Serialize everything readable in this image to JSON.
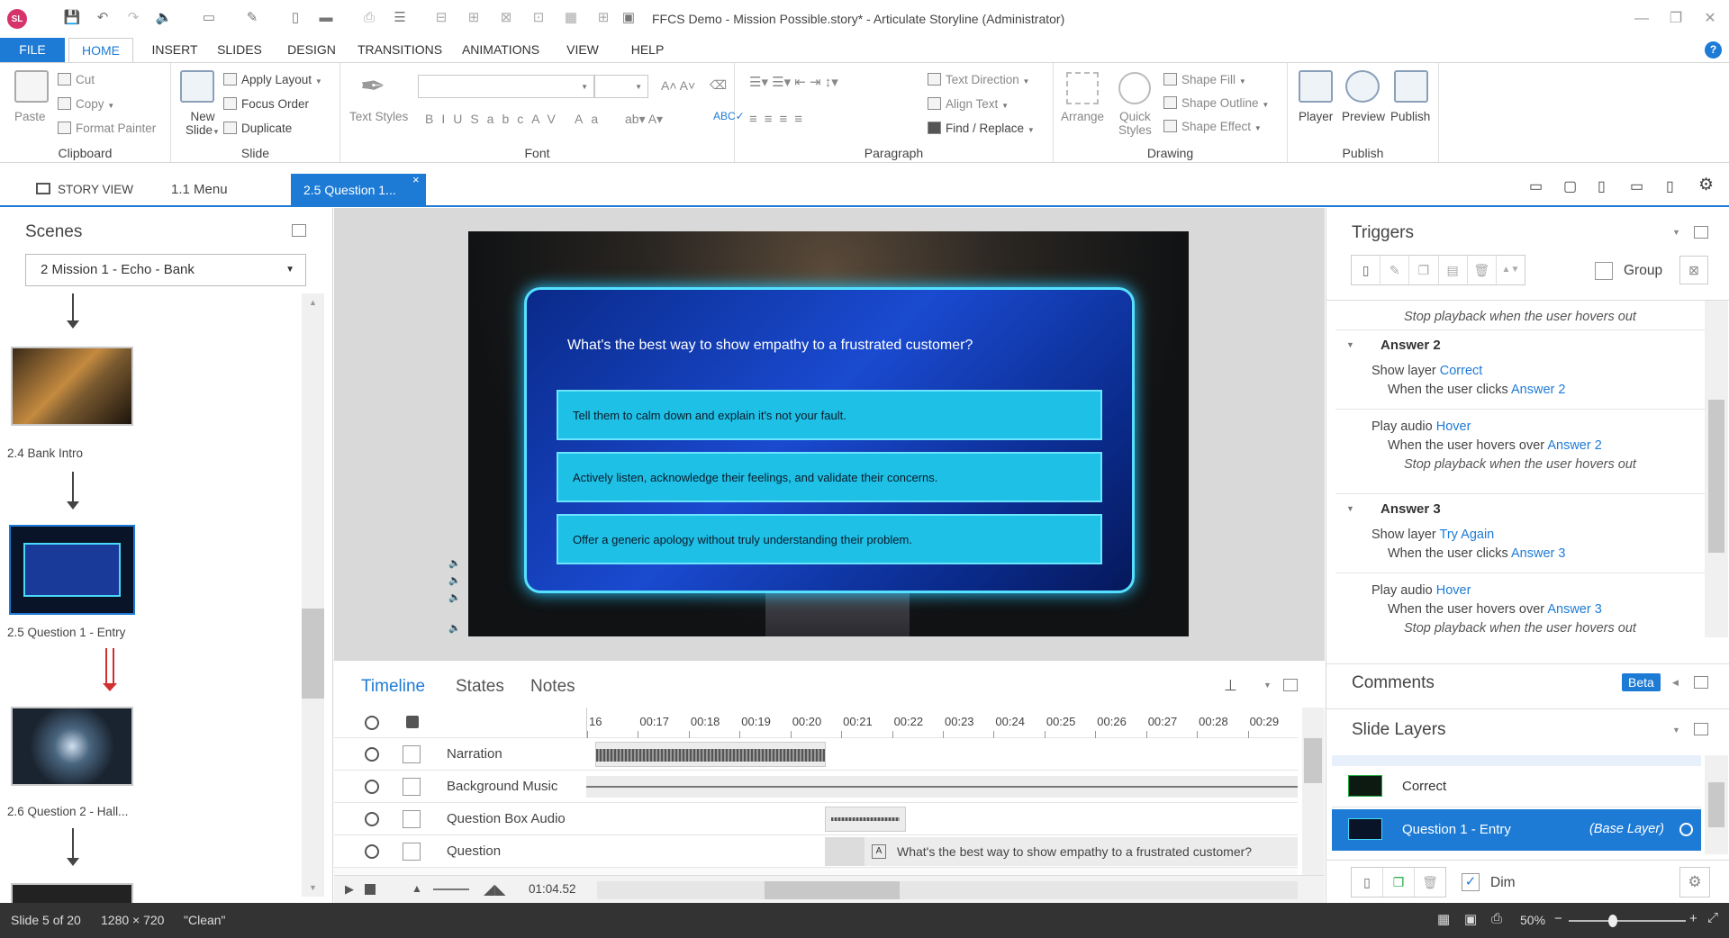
{
  "window": {
    "app_logo": "SL",
    "title": "FFCS Demo - Mission Possible.story* - Articulate Storyline (Administrator)"
  },
  "ribbon_tabs": [
    "FILE",
    "HOME",
    "INSERT",
    "SLIDES",
    "DESIGN",
    "TRANSITIONS",
    "ANIMATIONS",
    "VIEW",
    "HELP"
  ],
  "ribbon": {
    "clipboard": {
      "label": "Clipboard",
      "paste": "Paste",
      "cut": "Cut",
      "copy": "Copy",
      "format_painter": "Format Painter"
    },
    "slide": {
      "label": "Slide",
      "new_slide_line1": "New",
      "new_slide_line2": "Slide",
      "apply_layout": "Apply Layout",
      "focus_order": "Focus Order",
      "duplicate": "Duplicate"
    },
    "font": {
      "label": "Font",
      "text_styles": "Text Styles"
    },
    "paragraph": {
      "label": "Paragraph",
      "text_direction": "Text Direction",
      "align_text": "Align Text",
      "find_replace": "Find / Replace"
    },
    "drawing": {
      "label": "Drawing",
      "arrange": "Arrange",
      "quick_styles_line1": "Quick",
      "quick_styles_line2": "Styles",
      "shape_fill": "Shape Fill",
      "shape_outline": "Shape Outline",
      "shape_effect": "Shape Effect"
    },
    "publish": {
      "label": "Publish",
      "player": "Player",
      "preview": "Preview",
      "publish": "Publish"
    }
  },
  "view_tabs": {
    "story_view": "STORY VIEW",
    "menu": "1.1 Menu",
    "active": "2.5 Question 1..."
  },
  "scenes": {
    "title": "Scenes",
    "selected_scene": "2 Mission 1 - Echo - Bank",
    "slides": [
      {
        "label": "2.4 Bank Intro"
      },
      {
        "label": "2.5 Question 1 - Entry"
      },
      {
        "label": "2.6 Question 2 - Hall..."
      }
    ]
  },
  "slide": {
    "question": "What's the best way to show empathy to a frustrated customer?",
    "answers": [
      "Tell them to calm down and explain it's not your fault.",
      "Actively listen, acknowledge their feelings, and validate their concerns.",
      "Offer a generic apology without truly understanding their problem."
    ]
  },
  "timeline": {
    "tabs": [
      "Timeline",
      "States",
      "Notes"
    ],
    "ticks": [
      "16",
      "00:17",
      "00:18",
      "00:19",
      "00:20",
      "00:21",
      "00:22",
      "00:23",
      "00:24",
      "00:25",
      "00:26",
      "00:27",
      "00:28",
      "00:29"
    ],
    "rows": [
      "Narration",
      "Background Music",
      "Question Box Audio",
      "Question"
    ],
    "question_caption": "What's the best way to show empathy to a frustrated customer?",
    "duration": "01:04.52"
  },
  "triggers": {
    "title": "Triggers",
    "group_label": "Group",
    "top_line": "Stop playback when the user hovers out",
    "groups": [
      {
        "name": "Answer 2",
        "items": [
          {
            "action": "Show layer",
            "target": "Correct",
            "cond": "When the user clicks",
            "obj": "Answer 2"
          },
          {
            "action": "Play audio",
            "target": "Hover",
            "cond": "When the user hovers over",
            "obj": "Answer 2",
            "extra": "Stop playback when the user hovers out"
          }
        ]
      },
      {
        "name": "Answer 3",
        "items": [
          {
            "action": "Show layer",
            "target": "Try Again",
            "cond": "When the user clicks",
            "obj": "Answer 3"
          },
          {
            "action": "Play audio",
            "target": "Hover",
            "cond": "When the user hovers over",
            "obj": "Answer 3",
            "extra": "Stop playback when the user hovers out"
          }
        ]
      }
    ]
  },
  "comments": {
    "title": "Comments",
    "badge": "Beta"
  },
  "slide_layers": {
    "title": "Slide Layers",
    "layers": [
      {
        "name": "Correct",
        "base": ""
      },
      {
        "name": "Question 1 - Entry",
        "base": "(Base Layer)"
      }
    ],
    "dim_label": "Dim"
  },
  "status": {
    "slide": "Slide 5 of 20",
    "size": "1280 × 720",
    "theme": "\"Clean\"",
    "zoom": "50%"
  },
  "colors": {
    "accent": "#1d7bd6",
    "answer_fill": "#1ec0e6",
    "status_bg": "#333333"
  }
}
